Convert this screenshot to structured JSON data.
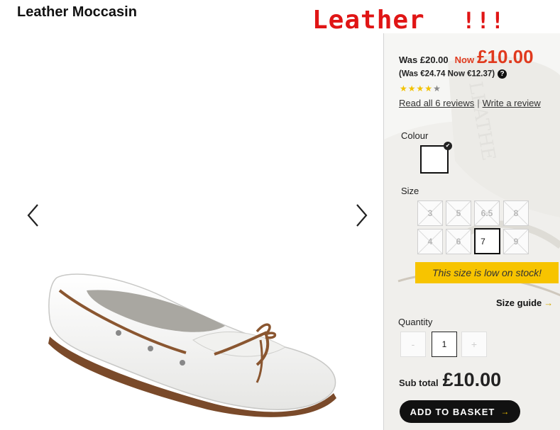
{
  "product": {
    "title": "Leather Moccasin"
  },
  "overlay": {
    "text": "Leather",
    "exclaim": "!!!",
    "color": "#e01515"
  },
  "gallery": {
    "prev_icon": "chevron-left-icon",
    "next_icon": "chevron-right-icon"
  },
  "price": {
    "was": "Was £20.00",
    "now_label": "Now",
    "now": "£10.00",
    "euro": "(Was €24.74 Now €12.37)",
    "accent": "#e03a1e"
  },
  "rating": {
    "stars_filled": 4,
    "stars_total": 5,
    "star_color": "#f2c200"
  },
  "reviews": {
    "read_all": "Read all 6 reviews",
    "separator": "|",
    "write": "Write a review"
  },
  "colour": {
    "label": "Colour",
    "selected_swatch": "#ffffff"
  },
  "size": {
    "label": "Size",
    "options": [
      "3",
      "5",
      "6.5",
      "8",
      "4",
      "6",
      "7",
      "9"
    ],
    "selected": "7",
    "stock_message": "This size is low on stock!",
    "stock_color": "#f7c400",
    "guide": "Size guide"
  },
  "quantity": {
    "label": "Quantity",
    "minus": "-",
    "value": "1",
    "plus": "+"
  },
  "subtotal": {
    "label": "Sub total",
    "value": "£10.00"
  },
  "basket": {
    "label": "ADD TO BASKET",
    "arrow": "→"
  }
}
